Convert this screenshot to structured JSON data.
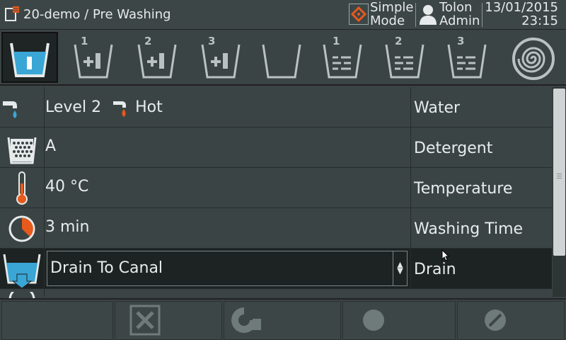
{
  "header": {
    "title": "20-demo / Pre Washing",
    "mode_line1": "Simple",
    "mode_line2": "Mode",
    "user_line1": "Tolon",
    "user_line2": "Admin",
    "date": "13/01/2015",
    "time": "23:15"
  },
  "phases": [
    {
      "name": "prewash",
      "num": "",
      "active": true
    },
    {
      "name": "dose-1",
      "num": "1"
    },
    {
      "name": "dose-2",
      "num": "2"
    },
    {
      "name": "dose-3",
      "num": "3"
    },
    {
      "name": "empty",
      "num": ""
    },
    {
      "name": "rinse-1",
      "num": "1"
    },
    {
      "name": "rinse-2",
      "num": "2"
    },
    {
      "name": "rinse-3",
      "num": "3"
    },
    {
      "name": "spin",
      "num": ""
    }
  ],
  "rows": {
    "water": {
      "level": "Level 2",
      "temp": "Hot",
      "label": "Water"
    },
    "detergent": {
      "value": "A",
      "label": "Detergent"
    },
    "temperature": {
      "value": "40  °C",
      "label": "Temperature"
    },
    "washing_time": {
      "value": "3  min",
      "label": "Washing Time"
    },
    "drain": {
      "value": "Drain  To  Canal",
      "label": "Drain"
    }
  },
  "colors": {
    "accent_blue": "#3aa6d6",
    "accent_orange": "#e8591c",
    "background": "#3b4444",
    "selected_row": "#1d2323"
  }
}
